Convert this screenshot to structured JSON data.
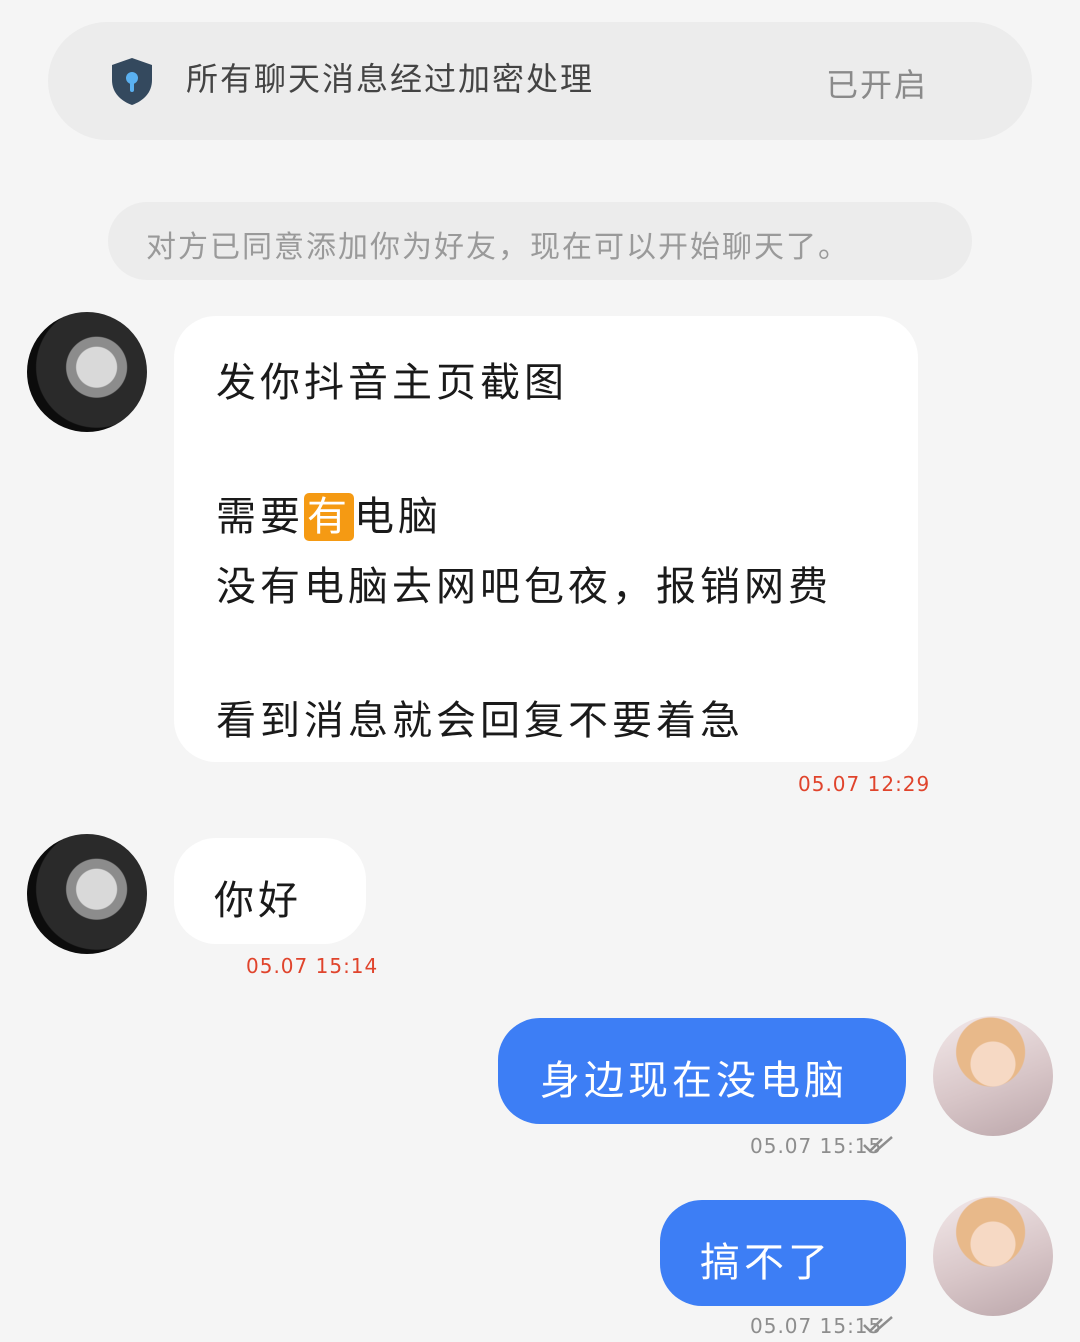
{
  "encryption_banner": {
    "text": "所有聊天消息经过加密处理",
    "status": "已开启",
    "icon": "shield-lock-icon"
  },
  "system_notice": "对方已同意添加你为好友，现在可以开始聊天了。",
  "messages": [
    {
      "direction": "incoming",
      "lines": {
        "l1": "发你抖音主页截图",
        "l2_prefix": "需要",
        "l2_highlight": "有",
        "l2_suffix": "电脑",
        "l3": "没有电脑去网吧包夜，报销网费",
        "l4": "看到消息就会回复不要着急"
      },
      "time": "05.07 12:29"
    },
    {
      "direction": "incoming",
      "text": "你好",
      "time": "05.07 15:14"
    },
    {
      "direction": "outgoing",
      "text": "身边现在没电脑",
      "time": "05.07 15:15",
      "read": true
    },
    {
      "direction": "outgoing",
      "text": "搞不了",
      "time": "05.07 15:15",
      "read": true
    }
  ],
  "colors": {
    "outgoing_bubble": "#3d7ef5",
    "incoming_bubble": "#ffffff",
    "incoming_time": "#e0442c",
    "outgoing_time": "#8d8d8d",
    "highlight": "#f59a13"
  }
}
